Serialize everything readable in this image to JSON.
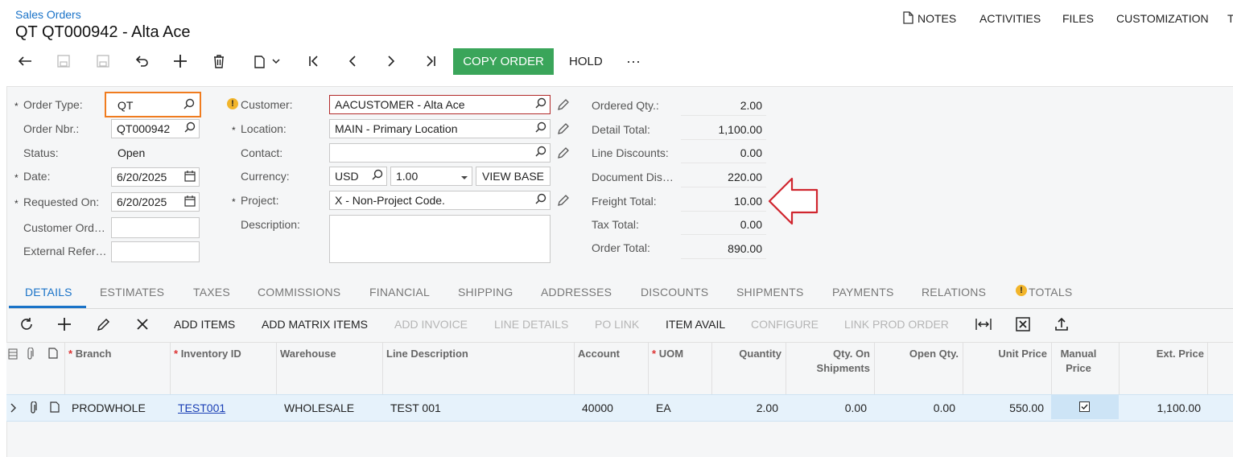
{
  "header": {
    "breadcrumb": "Sales Orders",
    "title": "QT QT000942 - Alta Ace",
    "nav": [
      "NOTES",
      "ACTIVITIES",
      "FILES",
      "CUSTOMIZATION",
      "T"
    ]
  },
  "toolbar": {
    "copy_order": "COPY ORDER",
    "hold": "HOLD",
    "more": "···"
  },
  "form": {
    "order_type_label": "Order Type:",
    "order_type": "QT",
    "order_nbr_label": "Order Nbr.:",
    "order_nbr": "QT000942",
    "status_label": "Status:",
    "status": "Open",
    "date_label": "Date:",
    "date": "6/20/2025",
    "requested_on_label": "Requested On:",
    "requested_on": "6/20/2025",
    "customer_order_label": "Customer Ord…",
    "customer_order": "",
    "external_ref_label": "External Refer…",
    "external_ref": "",
    "customer_label": "Customer:",
    "customer": "AACUSTOMER - Alta Ace",
    "location_label": "Location:",
    "location": "MAIN - Primary Location",
    "contact_label": "Contact:",
    "contact": "",
    "currency_label": "Currency:",
    "currency": "USD",
    "rate": "1.00",
    "view_base": "VIEW BASE",
    "project_label": "Project:",
    "project": "X - Non-Project Code.",
    "description_label": "Description:",
    "description": ""
  },
  "totals": {
    "ordered_qty_label": "Ordered Qty.:",
    "ordered_qty": "2.00",
    "detail_total_label": "Detail Total:",
    "detail_total": "1,100.00",
    "line_discounts_label": "Line Discounts:",
    "line_discounts": "0.00",
    "document_discount_label": "Document Dis…",
    "document_discount": "220.00",
    "freight_total_label": "Freight Total:",
    "freight_total": "10.00",
    "tax_total_label": "Tax Total:",
    "tax_total": "0.00",
    "order_total_label": "Order Total:",
    "order_total": "890.00"
  },
  "tabs": [
    "DETAILS",
    "ESTIMATES",
    "TAXES",
    "COMMISSIONS",
    "FINANCIAL",
    "SHIPPING",
    "ADDRESSES",
    "DISCOUNTS",
    "SHIPMENTS",
    "PAYMENTS",
    "RELATIONS",
    "TOTALS"
  ],
  "grid_toolbar": {
    "add_items": "ADD ITEMS",
    "add_matrix_items": "ADD MATRIX ITEMS",
    "add_invoice": "ADD INVOICE",
    "line_details": "LINE DETAILS",
    "po_link": "PO LINK",
    "item_avail": "ITEM AVAIL",
    "configure": "CONFIGURE",
    "link_prod_order": "LINK PROD ORDER"
  },
  "grid": {
    "columns": {
      "branch": "Branch",
      "inventory_id": "Inventory ID",
      "warehouse": "Warehouse",
      "line_description": "Line Description",
      "account": "Account",
      "uom": "UOM",
      "quantity": "Quantity",
      "qty_on_shipments": "Qty. On Shipments",
      "open_qty": "Open Qty.",
      "unit_price": "Unit Price",
      "manual_price": "Manual Price",
      "ext_price": "Ext. Price"
    },
    "rows": [
      {
        "branch": "PRODWHOLE",
        "inventory_id": "TEST001",
        "warehouse": "WHOLESALE",
        "line_description": "TEST 001",
        "account": "40000",
        "uom": "EA",
        "quantity": "2.00",
        "qty_on_shipments": "0.00",
        "open_qty": "0.00",
        "unit_price": "550.00",
        "manual_price": true,
        "ext_price": "1,100.00"
      }
    ]
  },
  "colors": {
    "accent": "#1a73c8",
    "copy_order_bg": "#3aa55a",
    "highlight_border": "#f07c1f",
    "arrow": "#d0262f"
  }
}
